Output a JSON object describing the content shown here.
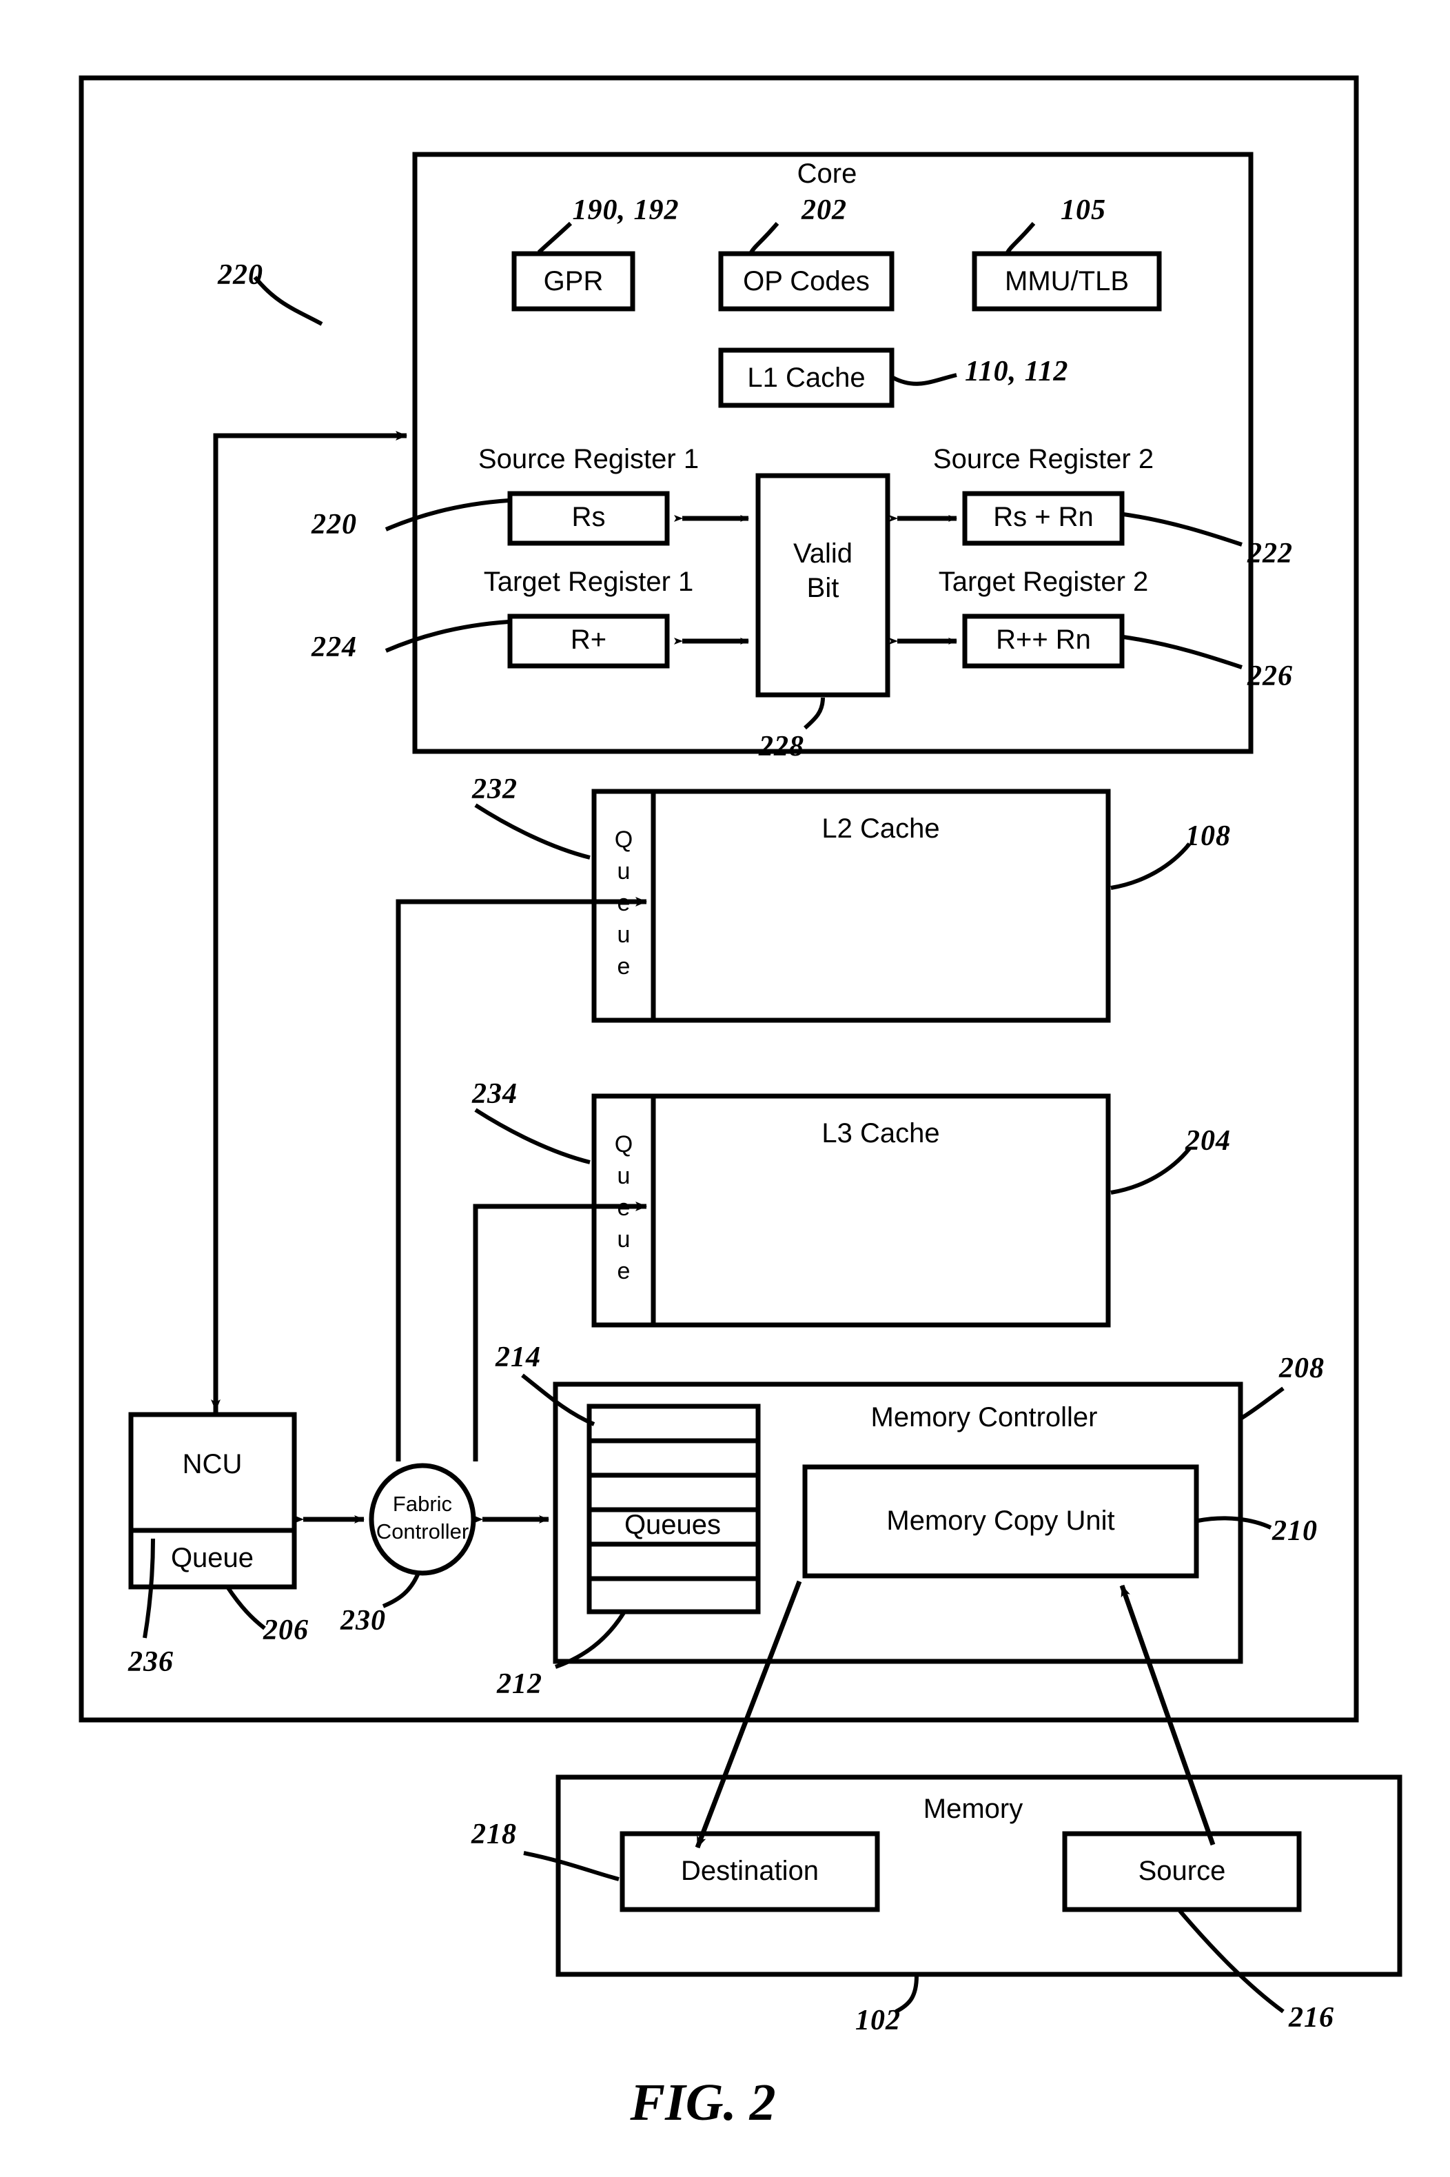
{
  "figure": {
    "caption": "FIG. 2"
  },
  "chip": {
    "core": {
      "title": "Core",
      "units": [
        {
          "label": "GPR",
          "ref": "190, 192"
        },
        {
          "label": "OP Codes",
          "ref": "202"
        },
        {
          "label": "MMU/TLB",
          "ref": "105"
        },
        {
          "label": "L1 Cache",
          "ref": "110, 112"
        }
      ],
      "registers": {
        "valid_bit": {
          "label": "Valid\nBit",
          "line1": "Valid",
          "line2": "Bit",
          "ref": "228"
        },
        "source_register_1": {
          "title": "Source Register 1",
          "value": "Rs",
          "ref": "220"
        },
        "source_register_2": {
          "title": "Source Register 2",
          "value": "Rs + Rn",
          "ref": "222"
        },
        "target_register_1": {
          "title": "Target Register 1",
          "value": "R+",
          "ref": "224"
        },
        "target_register_2": {
          "title": "Target Register 2",
          "value": "R++ Rn",
          "ref": "226"
        }
      },
      "inbound_ref": "220"
    },
    "l2_cache": {
      "label": "L2 Cache",
      "queue_label": "Queue",
      "queue_ref": "232",
      "ref": "108"
    },
    "l3_cache": {
      "label": "L3 Cache",
      "queue_label": "Queue",
      "queue_ref": "234",
      "ref": "204"
    },
    "ncu": {
      "label": "NCU",
      "queue_label": "Queue",
      "ref": "206",
      "queue_ref": "236"
    },
    "fabric_controller": {
      "line1": "Fabric",
      "line2": "Controller",
      "ref": "230"
    },
    "memory_controller": {
      "title": "Memory Controller",
      "ref": "208",
      "queues": {
        "label": "Queues",
        "ref": "212",
        "slot_ref": "214",
        "slots": 6
      },
      "memory_copy_unit": {
        "label": "Memory Copy Unit",
        "ref": "210"
      }
    }
  },
  "memory": {
    "title": "Memory",
    "ref": "102",
    "destination": {
      "label": "Destination",
      "ref": "218"
    },
    "source": {
      "label": "Source",
      "ref": "216"
    }
  },
  "colors": {
    "ink": "#000000",
    "paper": "#ffffff"
  }
}
